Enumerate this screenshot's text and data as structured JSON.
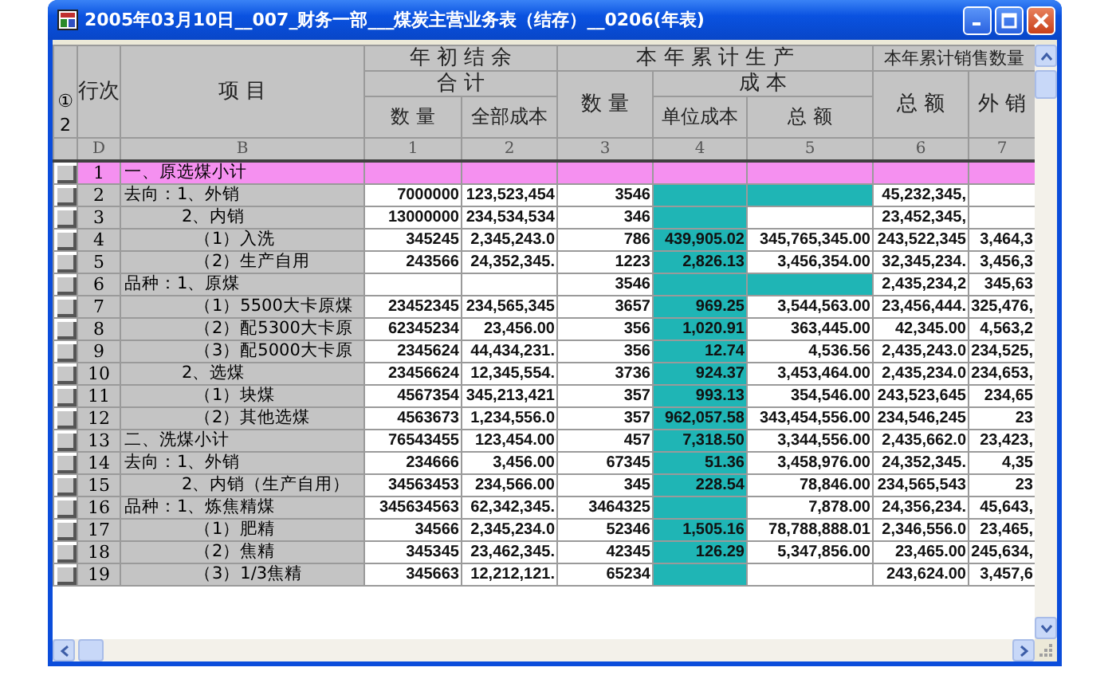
{
  "window": {
    "title": "2005年03月10日__007_财务一部___煤炭主营业务表（结存）__0206(年表)"
  },
  "outline_levels": [
    "①",
    "2"
  ],
  "header": {
    "row_number": "行次",
    "item": "项 目",
    "opening_balance": {
      "label": "年 初 结 余",
      "subtotal": "合 计",
      "quantity": "数 量",
      "total_cost": "全部成本"
    },
    "production": {
      "label": "本 年 累 计 生 产",
      "quantity": "数 量",
      "cost": "成 本",
      "unit_cost": "单位成本",
      "amount": "总 额"
    },
    "sales_quantity": {
      "label": "本年累计销售数量",
      "total": "总 额",
      "external": "外 销"
    }
  },
  "column_codes": [
    "D",
    "B",
    "1",
    "2",
    "3",
    "4",
    "5",
    "6",
    "7"
  ],
  "rows": [
    {
      "no": "1",
      "item": "一、原选煤小计",
      "kind": "top",
      "highlighted": true,
      "cells": [
        {
          "shaded": false
        },
        {
          "shaded": false
        },
        {
          "shaded": false
        },
        {
          "shaded": false
        },
        {
          "shaded": false
        },
        {
          "shaded": false
        },
        {
          "shaded": false
        }
      ]
    },
    {
      "no": "2",
      "item": "去向：1、外销",
      "kind": "top",
      "highlighted": false,
      "cells": [
        {
          "value": "7000000",
          "shaded": false
        },
        {
          "value": "123,523,454",
          "shaded": false
        },
        {
          "value": "3546",
          "shaded": false
        },
        {
          "shaded": true
        },
        {
          "shaded": true
        },
        {
          "value": "45,232,345,",
          "shaded": false
        },
        {
          "shaded": false
        }
      ]
    },
    {
      "no": "3",
      "item": "2、内销",
      "kind": "mid",
      "highlighted": false,
      "cells": [
        {
          "value": "13000000",
          "shaded": false
        },
        {
          "value": "234,534,534",
          "shaded": false
        },
        {
          "value": "346",
          "shaded": false
        },
        {
          "shaded": true
        },
        {
          "shaded": false
        },
        {
          "value": "23,452,345,",
          "shaded": false
        },
        {
          "shaded": false
        }
      ]
    },
    {
      "no": "4",
      "item": "（1）入洗",
      "kind": "leaf",
      "highlighted": false,
      "cells": [
        {
          "value": "345245",
          "shaded": false
        },
        {
          "value": "2,345,243.0",
          "shaded": false
        },
        {
          "value": "786",
          "shaded": false
        },
        {
          "value": "439,905.02",
          "shaded": true
        },
        {
          "value": "345,765,345.00",
          "shaded": false
        },
        {
          "value": "243,522,345",
          "shaded": false
        },
        {
          "value": "3,464,3",
          "shaded": false
        }
      ]
    },
    {
      "no": "5",
      "item": "（2）生产自用",
      "kind": "leaf",
      "highlighted": false,
      "cells": [
        {
          "value": "243566",
          "shaded": false
        },
        {
          "value": "24,352,345.",
          "shaded": false
        },
        {
          "value": "1223",
          "shaded": false
        },
        {
          "value": "2,826.13",
          "shaded": true
        },
        {
          "value": "3,456,354.00",
          "shaded": false
        },
        {
          "value": "32,345,234.",
          "shaded": false
        },
        {
          "value": "3,456,3",
          "shaded": false
        }
      ]
    },
    {
      "no": "6",
      "item": "品种：1、原煤",
      "kind": "top",
      "highlighted": false,
      "cells": [
        {
          "shaded": false
        },
        {
          "shaded": false
        },
        {
          "value": "3546",
          "shaded": false
        },
        {
          "shaded": true
        },
        {
          "shaded": true
        },
        {
          "value": "2,435,234,2",
          "shaded": false
        },
        {
          "value": "345,63",
          "shaded": false
        }
      ]
    },
    {
      "no": "7",
      "item": "（1）5500大卡原煤",
      "kind": "leaf",
      "highlighted": false,
      "cells": [
        {
          "value": "23452345",
          "shaded": false
        },
        {
          "value": "234,565,345",
          "shaded": false
        },
        {
          "value": "3657",
          "shaded": false
        },
        {
          "value": "969.25",
          "shaded": true
        },
        {
          "value": "3,544,563.00",
          "shaded": false
        },
        {
          "value": "23,456,444.",
          "shaded": false
        },
        {
          "value": "325,476,",
          "shaded": false
        }
      ]
    },
    {
      "no": "8",
      "item": "（2）配5300大卡原",
      "kind": "leaf",
      "highlighted": false,
      "cells": [
        {
          "value": "62345234",
          "shaded": false
        },
        {
          "value": "23,456.00",
          "shaded": false
        },
        {
          "value": "356",
          "shaded": false
        },
        {
          "value": "1,020.91",
          "shaded": true
        },
        {
          "value": "363,445.00",
          "shaded": false
        },
        {
          "value": "42,345.00",
          "shaded": false
        },
        {
          "value": "4,563,2",
          "shaded": false
        }
      ]
    },
    {
      "no": "9",
      "item": "（3）配5000大卡原",
      "kind": "leaf",
      "highlighted": false,
      "cells": [
        {
          "value": "2345624",
          "shaded": false
        },
        {
          "value": "44,434,231.",
          "shaded": false
        },
        {
          "value": "356",
          "shaded": false
        },
        {
          "value": "12.74",
          "shaded": true
        },
        {
          "value": "4,536.56",
          "shaded": false
        },
        {
          "value": "2,435,243.0",
          "shaded": false
        },
        {
          "value": "234,525,",
          "shaded": false
        }
      ]
    },
    {
      "no": "10",
      "item": "2、选煤",
      "kind": "mid",
      "highlighted": false,
      "cells": [
        {
          "value": "23456624",
          "shaded": false
        },
        {
          "value": "12,345,554.",
          "shaded": false
        },
        {
          "value": "3736",
          "shaded": false
        },
        {
          "value": "924.37",
          "shaded": true
        },
        {
          "value": "3,453,464.00",
          "shaded": false
        },
        {
          "value": "2,435,234.0",
          "shaded": false
        },
        {
          "value": "234,653,",
          "shaded": false
        }
      ]
    },
    {
      "no": "11",
      "item": "（1）块煤",
      "kind": "leaf",
      "highlighted": false,
      "cells": [
        {
          "value": "4567354",
          "shaded": false
        },
        {
          "value": "345,213,421",
          "shaded": false
        },
        {
          "value": "357",
          "shaded": false
        },
        {
          "value": "993.13",
          "shaded": true
        },
        {
          "value": "354,546.00",
          "shaded": false
        },
        {
          "value": "243,523,645",
          "shaded": false
        },
        {
          "value": "234,65",
          "shaded": false
        }
      ]
    },
    {
      "no": "12",
      "item": "（2）其他选煤",
      "kind": "leaf",
      "highlighted": false,
      "cells": [
        {
          "value": "4563673",
          "shaded": false
        },
        {
          "value": "1,234,556.0",
          "shaded": false
        },
        {
          "value": "357",
          "shaded": false
        },
        {
          "value": "962,057.58",
          "shaded": true
        },
        {
          "value": "343,454,556.00",
          "shaded": false
        },
        {
          "value": "234,546,245",
          "shaded": false
        },
        {
          "value": "23",
          "shaded": false
        }
      ]
    },
    {
      "no": "13",
      "item": "二、洗煤小计",
      "kind": "top",
      "highlighted": false,
      "cells": [
        {
          "value": "76543455",
          "shaded": false
        },
        {
          "value": "123,454.00",
          "shaded": false
        },
        {
          "value": "457",
          "shaded": false
        },
        {
          "value": "7,318.50",
          "shaded": true
        },
        {
          "value": "3,344,556.00",
          "shaded": false
        },
        {
          "value": "2,435,662.0",
          "shaded": false
        },
        {
          "value": "23,423,",
          "shaded": false
        }
      ]
    },
    {
      "no": "14",
      "item": "去向：1、外销",
      "kind": "top",
      "highlighted": false,
      "cells": [
        {
          "value": "234666",
          "shaded": false
        },
        {
          "value": "3,456.00",
          "shaded": false
        },
        {
          "value": "67345",
          "shaded": false
        },
        {
          "value": "51.36",
          "shaded": true
        },
        {
          "value": "3,458,976.00",
          "shaded": false
        },
        {
          "value": "24,352,345.",
          "shaded": false
        },
        {
          "value": "4,35",
          "shaded": false
        }
      ]
    },
    {
      "no": "15",
      "item": "2、内销（生产自用）",
      "kind": "mid",
      "highlighted": false,
      "cells": [
        {
          "value": "34563453",
          "shaded": false
        },
        {
          "value": "234,566.00",
          "shaded": false
        },
        {
          "value": "345",
          "shaded": false
        },
        {
          "value": "228.54",
          "shaded": true
        },
        {
          "value": "78,846.00",
          "shaded": false
        },
        {
          "value": "234,565,543",
          "shaded": false
        },
        {
          "value": "23",
          "shaded": false
        }
      ]
    },
    {
      "no": "16",
      "item": "品种：1、炼焦精煤",
      "kind": "top",
      "highlighted": false,
      "cells": [
        {
          "value": "345634563",
          "shaded": false
        },
        {
          "value": "62,342,345.",
          "shaded": false
        },
        {
          "value": "3464325",
          "shaded": false
        },
        {
          "shaded": true
        },
        {
          "value": "7,878.00",
          "shaded": false
        },
        {
          "value": "24,356,234.",
          "shaded": false
        },
        {
          "value": "45,643,",
          "shaded": false
        }
      ]
    },
    {
      "no": "17",
      "item": "（1）肥精",
      "kind": "leaf",
      "highlighted": false,
      "cells": [
        {
          "value": "34566",
          "shaded": false
        },
        {
          "value": "2,345,234.0",
          "shaded": false
        },
        {
          "value": "52346",
          "shaded": false
        },
        {
          "value": "1,505.16",
          "shaded": true
        },
        {
          "value": "78,788,888.01",
          "shaded": false
        },
        {
          "value": "2,346,556.0",
          "shaded": false
        },
        {
          "value": "23,465,",
          "shaded": false
        }
      ]
    },
    {
      "no": "18",
      "item": "（2）焦精",
      "kind": "leaf",
      "highlighted": false,
      "cells": [
        {
          "value": "345345",
          "shaded": false
        },
        {
          "value": "23,462,345.",
          "shaded": false
        },
        {
          "value": "42345",
          "shaded": false
        },
        {
          "value": "126.29",
          "shaded": true
        },
        {
          "value": "5,347,856.00",
          "shaded": false
        },
        {
          "value": "23,465.00",
          "shaded": false
        },
        {
          "value": "245,634,",
          "shaded": false
        }
      ]
    },
    {
      "no": "19",
      "item": "（3）1/3焦精",
      "kind": "leaf",
      "highlighted": false,
      "cells": [
        {
          "value": "345663",
          "shaded": false
        },
        {
          "value": "12,212,121.",
          "shaded": false
        },
        {
          "value": "65234",
          "shaded": false
        },
        {
          "shaded": true
        },
        {
          "shaded": false
        },
        {
          "value": "243,624.00",
          "shaded": false
        },
        {
          "value": "3,457,6",
          "shaded": false
        }
      ]
    }
  ]
}
